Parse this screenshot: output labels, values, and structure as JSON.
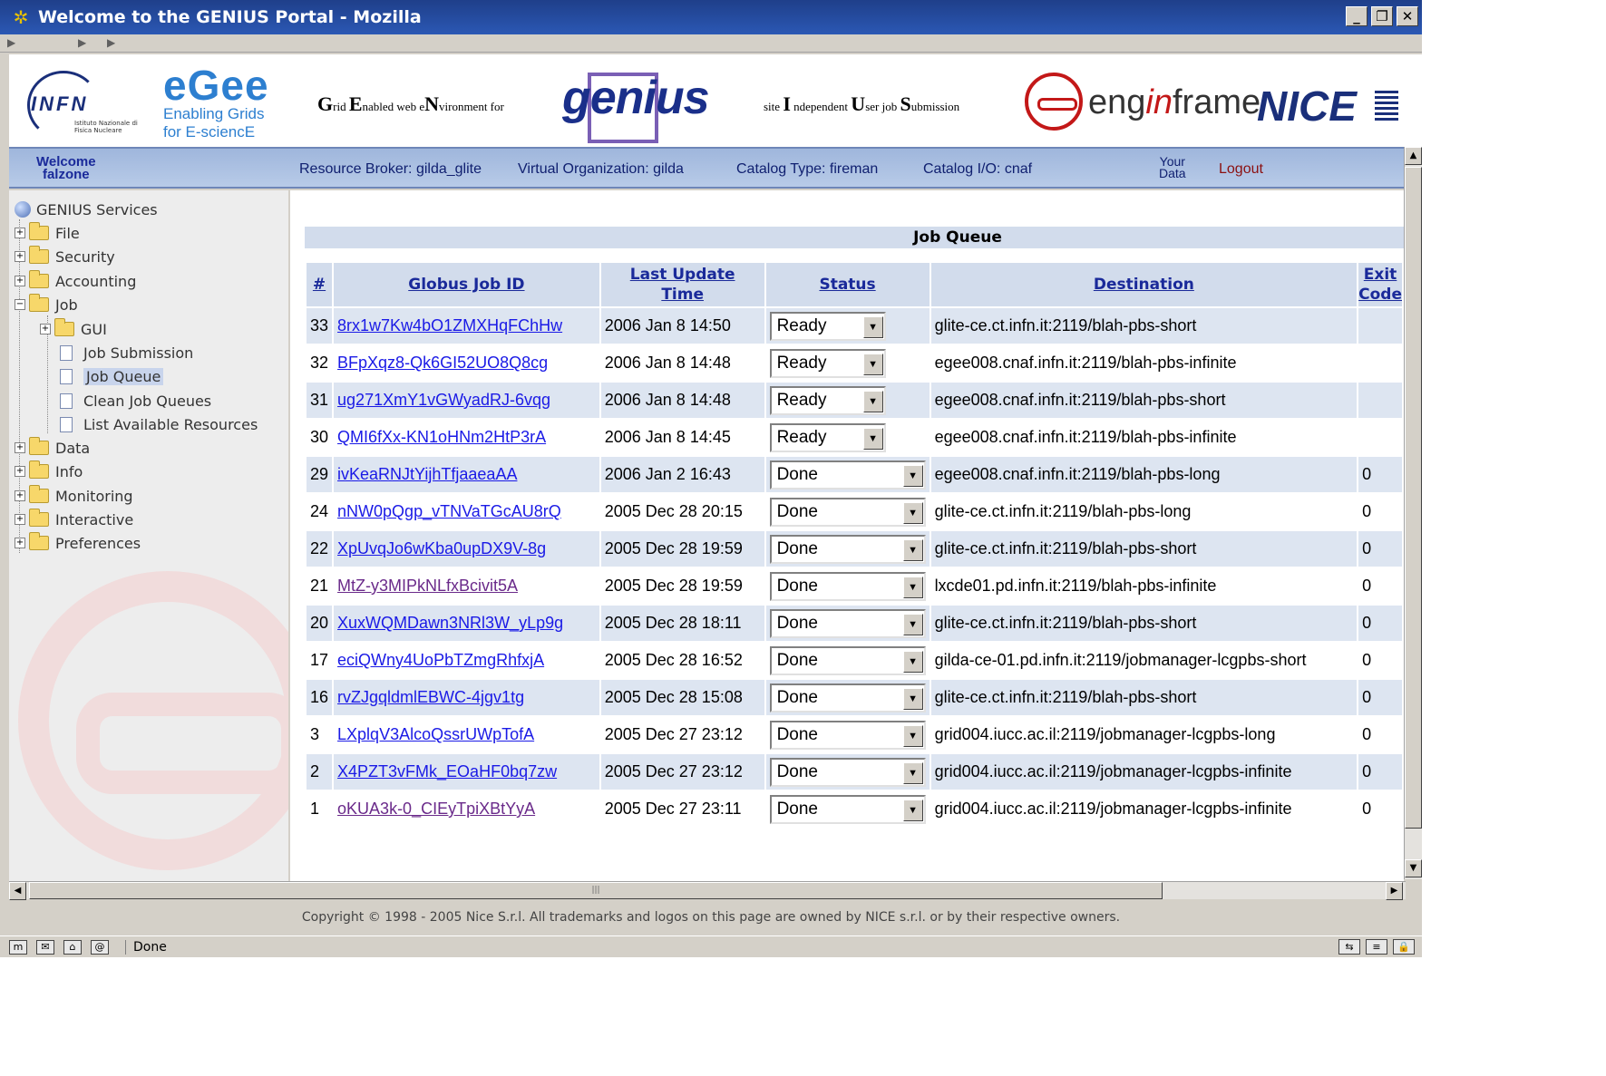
{
  "window": {
    "title": "Welcome to the GENIUS Portal - Mozilla",
    "controls": [
      "_",
      "❐",
      "✕"
    ]
  },
  "banner": {
    "infn_logo": "INFN",
    "infn_sub": "Istituto Nazionale di Fisica Nucleare",
    "egee_logo": "eGee",
    "egee_sub_1": "Enabling Grids",
    "egee_sub_2": "for E-sciencE",
    "genius_acronym_parts": [
      "G",
      "rid ",
      "E",
      "nabled web e",
      "N",
      "vironment for"
    ],
    "genius_logo": "genius",
    "user_acronym_parts": [
      "site ",
      "I",
      " ndependent ",
      "U",
      "ser job ",
      "S",
      "ubmission"
    ],
    "enginframe_logo_pre": "eng",
    "enginframe_logo_in": "in",
    "enginframe_logo_post": "frame",
    "nice_logo": "NICE"
  },
  "infobar": {
    "welcome": "Welcome",
    "user": "falzone",
    "resource_broker": "Resource Broker: gilda_glite",
    "virtual_org": "Virtual Organization: gilda",
    "catalog_type": "Catalog Type: fireman",
    "catalog_io": "Catalog I/O: cnaf",
    "your_data_1": "Your",
    "your_data_2": "Data",
    "logout": "Logout"
  },
  "sidebar": {
    "root": "GENIUS Services",
    "items": [
      "File",
      "Security",
      "Accounting",
      "Job",
      "GUI",
      "Job Submission",
      "Job Queue",
      "Clean Job Queues",
      "List Available Resources",
      "Data",
      "Info",
      "Monitoring",
      "Interactive",
      "Preferences"
    ]
  },
  "job_queue": {
    "title": "Job Queue",
    "headers": {
      "num": "#",
      "id": "Globus Job ID",
      "update_1": "Last Update",
      "update_2": "Time",
      "status": "Status",
      "destination": "Destination",
      "exit_1": "Exit",
      "exit_2": "Code"
    },
    "rows": [
      {
        "num": "33",
        "id": "8rx1w7Kw4bO1ZMXHqFChHw",
        "time": "2006 Jan 8 14:50",
        "status": "Ready",
        "dest": "glite-ce.ct.infn.it:2119/blah-pbs-short",
        "exit": ""
      },
      {
        "num": "32",
        "id": "BFpXqz8-Qk6GI52UO8Q8cg",
        "time": "2006 Jan 8 14:48",
        "status": "Ready",
        "dest": "egee008.cnaf.infn.it:2119/blah-pbs-infinite",
        "exit": ""
      },
      {
        "num": "31",
        "id": "ug271XmY1vGWyadRJ-6vqg",
        "time": "2006 Jan 8 14:48",
        "status": "Ready",
        "dest": "egee008.cnaf.infn.it:2119/blah-pbs-short",
        "exit": ""
      },
      {
        "num": "30",
        "id": "QMI6fXx-KN1oHNm2HtP3rA",
        "time": "2006 Jan 8 14:45",
        "status": "Ready",
        "dest": "egee008.cnaf.infn.it:2119/blah-pbs-infinite",
        "exit": ""
      },
      {
        "num": "29",
        "id": "ivKeaRNJtYijhTfjaaeaAA",
        "time": "2006 Jan 2 16:43",
        "status": "Done",
        "dest": "egee008.cnaf.infn.it:2119/blah-pbs-long",
        "exit": "0"
      },
      {
        "num": "24",
        "id": "nNW0pQgp_vTNVaTGcAU8rQ",
        "time": "2005 Dec 28 20:15",
        "status": "Done",
        "dest": "glite-ce.ct.infn.it:2119/blah-pbs-long",
        "exit": "0"
      },
      {
        "num": "22",
        "id": "XpUvqJo6wKba0upDX9V-8g",
        "time": "2005 Dec 28 19:59",
        "status": "Done",
        "dest": "glite-ce.ct.infn.it:2119/blah-pbs-short",
        "exit": "0"
      },
      {
        "num": "21",
        "id": "MtZ-y3MIPkNLfxBcivit5A",
        "time": "2005 Dec 28 19:59",
        "status": "Done",
        "dest": "lxcde01.pd.infn.it:2119/blah-pbs-infinite",
        "exit": "0"
      },
      {
        "num": "20",
        "id": "XuxWQMDawn3NRl3W_yLp9g",
        "time": "2005 Dec 28 18:11",
        "status": "Done",
        "dest": "glite-ce.ct.infn.it:2119/blah-pbs-short",
        "exit": "0"
      },
      {
        "num": "17",
        "id": "eciQWny4UoPbTZmgRhfxjA",
        "time": "2005 Dec 28 16:52",
        "status": "Done",
        "dest": "gilda-ce-01.pd.infn.it:2119/jobmanager-lcgpbs-short",
        "exit": "0"
      },
      {
        "num": "16",
        "id": "rvZJgqldmlEBWC-4jgv1tg",
        "time": "2005 Dec 28 15:08",
        "status": "Done",
        "dest": "glite-ce.ct.infn.it:2119/blah-pbs-short",
        "exit": "0"
      },
      {
        "num": "3",
        "id": "LXplqV3AlcoQssrUWpTofA",
        "time": "2005 Dec 27 23:12",
        "status": "Done",
        "dest": "grid004.iucc.ac.il:2119/jobmanager-lcgpbs-long",
        "exit": "0"
      },
      {
        "num": "2",
        "id": "X4PZT3vFMk_EOaHF0bq7zw",
        "time": "2005 Dec 27 23:12",
        "status": "Done",
        "dest": "grid004.iucc.ac.il:2119/jobmanager-lcgpbs-infinite",
        "exit": "0"
      },
      {
        "num": "1",
        "id": "oKUA3k-0_CIEyTpiXBtYyA",
        "time": "2005 Dec 27 23:11",
        "status": "Done",
        "dest": "grid004.iucc.ac.il:2119/jobmanager-lcgpbs-infinite",
        "exit": "0"
      }
    ]
  },
  "footer": {
    "copyright": "Copyright © 1998 - 2005 Nice S.r.l. All trademarks and logos on this page are owned by NICE s.r.l. or by their respective owners.",
    "status": "Done"
  }
}
